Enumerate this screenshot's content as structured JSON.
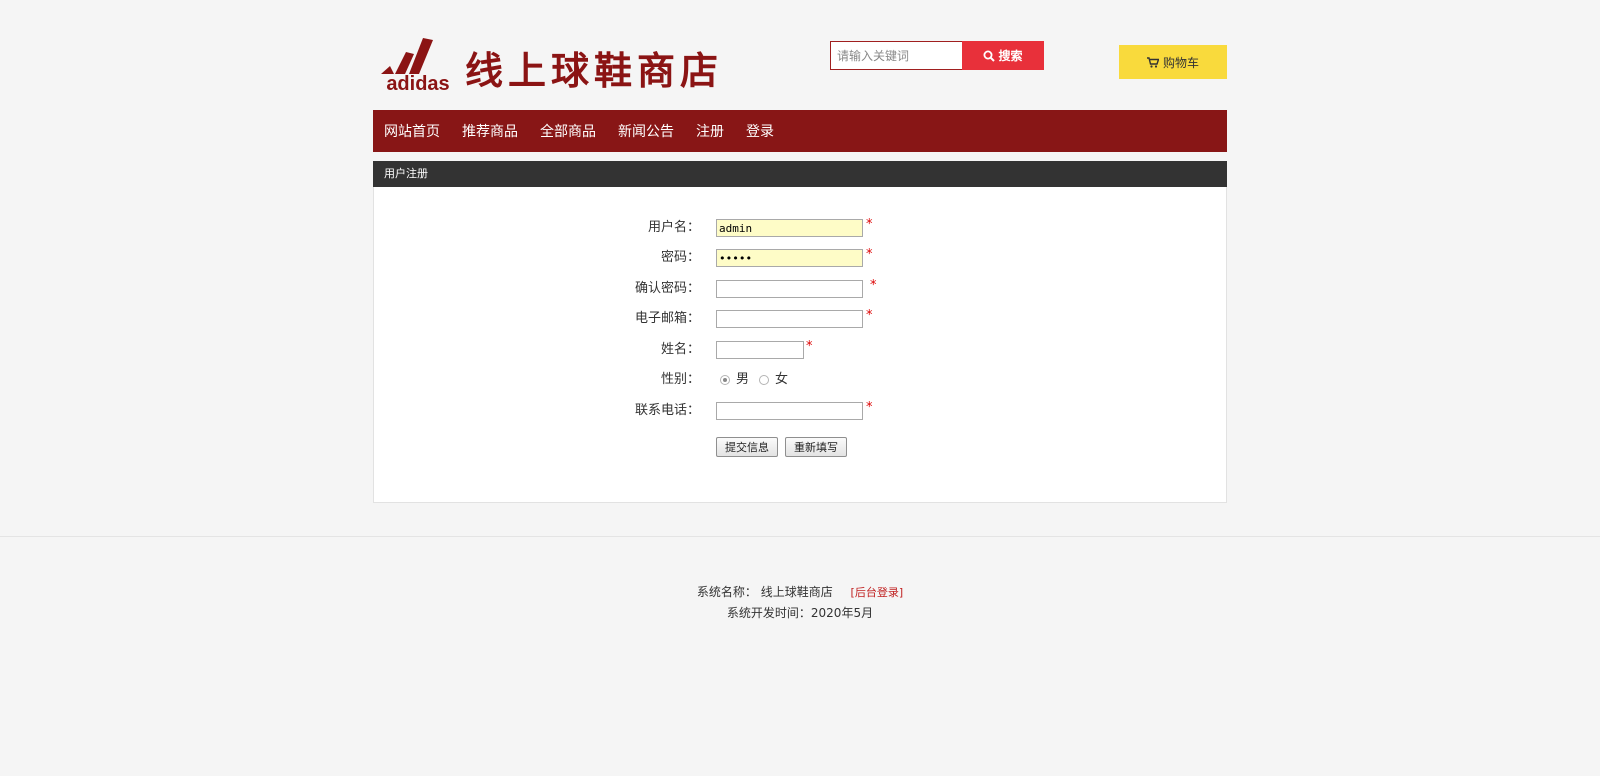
{
  "header": {
    "logo_text": "adidas",
    "title": "线上球鞋商店",
    "search": {
      "placeholder": "请输入关键词",
      "button_label": "搜索"
    },
    "cart_label": "购物车"
  },
  "nav": {
    "items": [
      {
        "label": "网站首页"
      },
      {
        "label": "推荐商品"
      },
      {
        "label": "全部商品"
      },
      {
        "label": "新闻公告"
      },
      {
        "label": "注册"
      },
      {
        "label": "登录"
      }
    ]
  },
  "panel": {
    "title": "用户注册",
    "form": {
      "username": {
        "label": "用户名：",
        "value": "admin"
      },
      "password": {
        "label": "密码：",
        "value": "•••••"
      },
      "confirm_password": {
        "label": "确认密码：",
        "value": ""
      },
      "email": {
        "label": "电子邮箱：",
        "value": ""
      },
      "name": {
        "label": "姓名：",
        "value": ""
      },
      "gender": {
        "label": "性别：",
        "options": [
          "男",
          "女"
        ],
        "selected": "男"
      },
      "phone": {
        "label": "联系电话：",
        "value": ""
      },
      "required_mark": "*",
      "submit_label": "提交信息",
      "reset_label": "重新填写"
    }
  },
  "footer": {
    "system_name_label": "系统名称：",
    "system_name": "线上球鞋商店",
    "admin_login": "[后台登录]",
    "dev_time_label": "系统开发时间：",
    "dev_time": "2020年5月"
  },
  "colors": {
    "brand_red": "#881616",
    "search_red": "#e8303a",
    "cart_yellow": "#f9da3c",
    "panel_head": "#333333"
  }
}
